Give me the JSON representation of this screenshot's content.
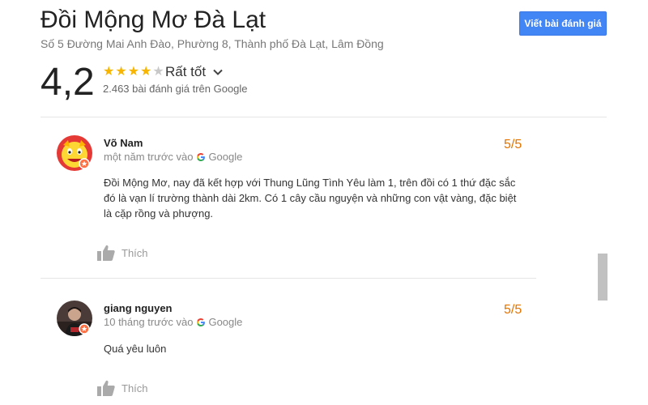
{
  "place": {
    "name": "Đồi Mộng Mơ Đà Lạt",
    "address": "Số 5 Đường Mai Anh Đào, Phường 8, Thành phố Đà Lạt, Lâm Đồng",
    "write_review_label": "Viết bài đánh giá",
    "rating": "4,2",
    "stars_filled": 4,
    "stars_total": 5,
    "rating_word": "Rất tốt",
    "review_count_text": "2.463 bài đánh giá trên Google"
  },
  "reviews": [
    {
      "author": "Võ Nam",
      "time": "một năm trước vào",
      "source": "Google",
      "score": "5/5",
      "text": "Đồi Mộng Mơ, nay đã kết hợp với Thung Lũng Tình Yêu làm 1, trên đồi có 1 thứ đặc sắc đó là vạn lí trường thành dài 2km. Có 1 cây cầu nguyện và những con vật vàng, đặc biệt là cặp rồng và phượng.",
      "like_label": "Thích"
    },
    {
      "author": "giang nguyen",
      "time": "10 tháng trước vào",
      "source": "Google",
      "score": "5/5",
      "text": "Quá yêu luôn",
      "like_label": "Thích"
    }
  ],
  "colors": {
    "accent_button": "#4285f4",
    "star": "#f7b500",
    "score": "#e37400"
  },
  "icons": [
    "chevron-down-icon",
    "google-g-icon",
    "thumbs-up-icon",
    "local-guide-badge-icon"
  ]
}
